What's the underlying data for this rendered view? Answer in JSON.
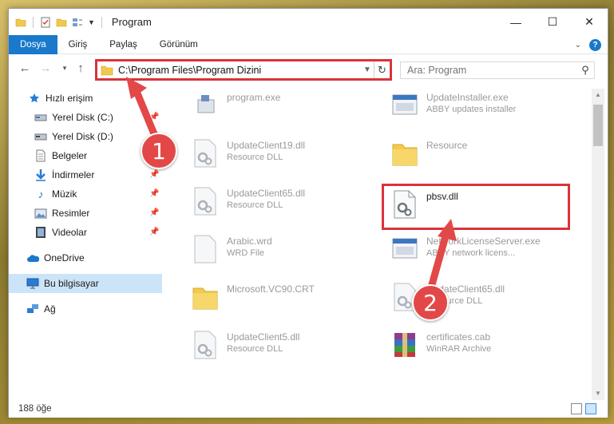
{
  "window": {
    "title": "Program"
  },
  "ribbon": {
    "tabs": [
      "Dosya",
      "Giriş",
      "Paylaş",
      "Görünüm"
    ],
    "help": "?"
  },
  "address": {
    "path": "C:\\Program Files\\Program Dizini"
  },
  "search": {
    "placeholder": "Ara: Program"
  },
  "nav": {
    "quick_access": "Hızlı erişim",
    "items": [
      {
        "label": "Yerel Disk (C:)",
        "pinned": true
      },
      {
        "label": "Yerel Disk (D:)",
        "pinned": true
      },
      {
        "label": "Belgeler",
        "pinned": true
      },
      {
        "label": "İndirmeler",
        "pinned": true
      },
      {
        "label": "Müzik",
        "pinned": true
      },
      {
        "label": "Resimler",
        "pinned": true
      },
      {
        "label": "Videolar",
        "pinned": true
      }
    ],
    "onedrive": "OneDrive",
    "this_pc": "Bu bilgisayar",
    "network": "Ağ"
  },
  "files": [
    {
      "name": "program.exe",
      "desc": "",
      "icon": "exe-icon"
    },
    {
      "name": "UpdateInstaller.exe",
      "desc": "ABBY updates installer",
      "icon": "installer-icon"
    },
    {
      "name": "UpdateClient19.dll",
      "desc": "Resource DLL",
      "icon": "dll-icon"
    },
    {
      "name": "Resource",
      "desc": "",
      "icon": "folder-icon"
    },
    {
      "name": "UpdateClient65.dll",
      "desc": "Resource DLL",
      "icon": "dll-icon"
    },
    {
      "name": "pbsv.dll",
      "desc": "",
      "icon": "dll-icon"
    },
    {
      "name": "Arabic.wrd",
      "desc": "WRD File",
      "icon": "file-icon"
    },
    {
      "name": "NetworkLicenseServer.exe",
      "desc": "ABBY network licens...",
      "icon": "installer-icon"
    },
    {
      "name": "Microsoft.VC90.CRT",
      "desc": "",
      "icon": "folder-icon"
    },
    {
      "name": "UpdateClient65.dll",
      "desc": "Resource DLL",
      "icon": "dll-icon"
    },
    {
      "name": "UpdateClient5.dll",
      "desc": "Resource DLL",
      "icon": "dll-icon"
    },
    {
      "name": "certificates.cab",
      "desc": "WinRAR Archive",
      "icon": "archive-icon"
    }
  ],
  "status": {
    "count": "188 öğe"
  },
  "callouts": [
    "1",
    "2"
  ],
  "colors": {
    "accent": "#1979ca",
    "highlight": "#d9343a",
    "selected": "#cce4f7"
  }
}
